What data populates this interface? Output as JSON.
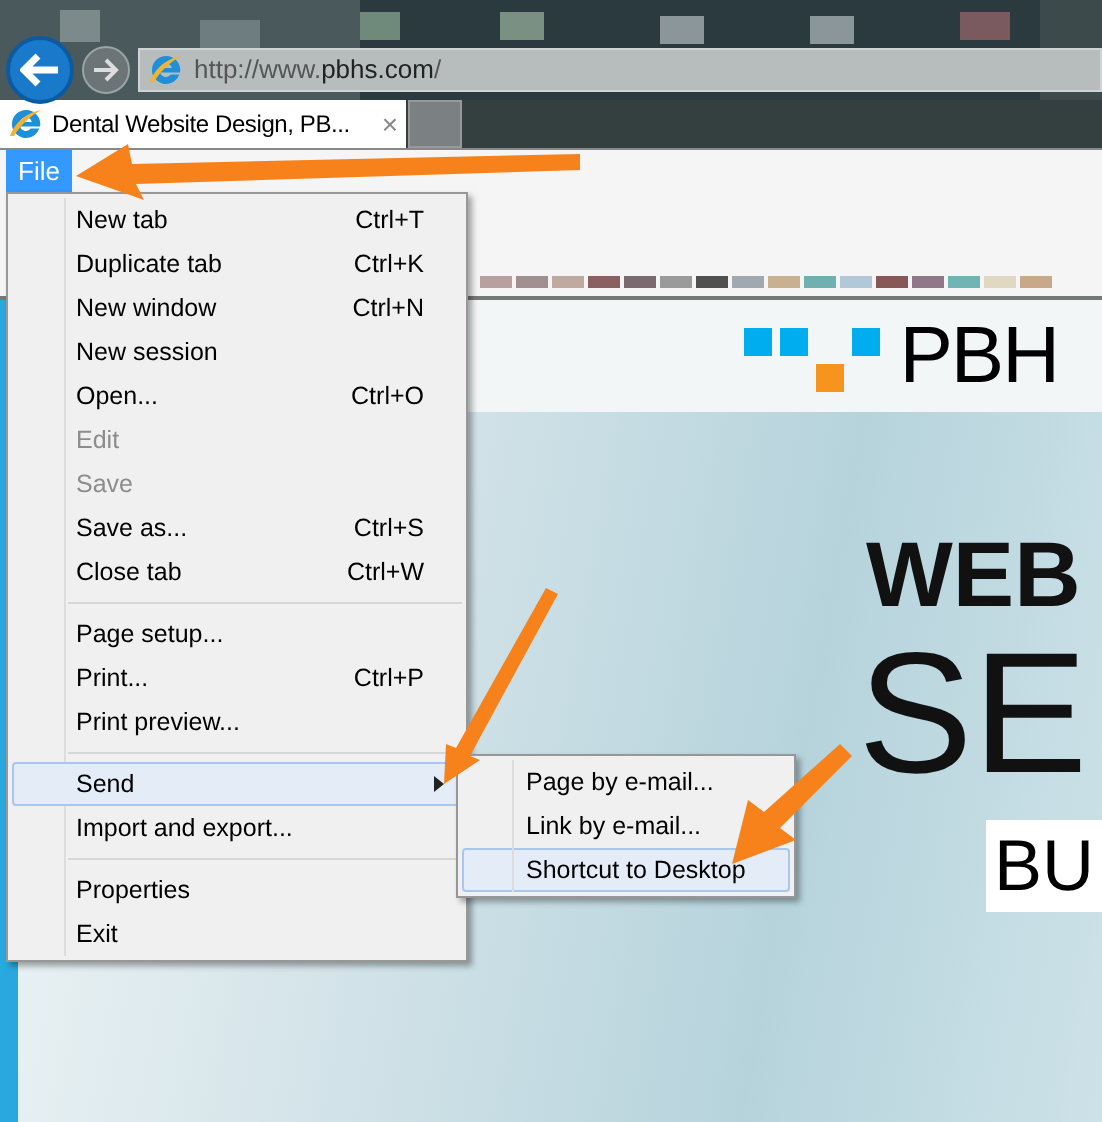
{
  "browser": {
    "address": "http://www.**pbhs.com**/",
    "tab": {
      "title": "Dental Website Design, PB...",
      "close": "×"
    }
  },
  "menu_bar": [
    {
      "label": "File",
      "selected": true
    }
  ],
  "file_menu": [
    {
      "kind": "item",
      "label": "New tab",
      "shortcut": "Ctrl+T",
      "disabled": false,
      "selected": false
    },
    {
      "kind": "item",
      "label": "Duplicate tab",
      "shortcut": "Ctrl+K",
      "disabled": false,
      "selected": false
    },
    {
      "kind": "item",
      "label": "New window",
      "shortcut": "Ctrl+N",
      "disabled": false,
      "selected": false
    },
    {
      "kind": "item",
      "label": "New session",
      "disabled": false,
      "selected": false
    },
    {
      "kind": "item",
      "label": "Open...",
      "shortcut": "Ctrl+O",
      "disabled": false,
      "selected": false
    },
    {
      "kind": "item",
      "label": "Edit",
      "disabled": true,
      "selected": false
    },
    {
      "kind": "item",
      "label": "Save",
      "disabled": true,
      "selected": false
    },
    {
      "kind": "item",
      "label": "Save as...",
      "shortcut": "Ctrl+S",
      "disabled": false,
      "selected": false
    },
    {
      "kind": "item",
      "label": "Close tab",
      "shortcut": "Ctrl+W",
      "disabled": false,
      "selected": false
    },
    {
      "kind": "separator"
    },
    {
      "kind": "item",
      "label": "Page setup...",
      "disabled": false,
      "selected": false
    },
    {
      "kind": "item",
      "label": "Print...",
      "shortcut": "Ctrl+P",
      "disabled": false,
      "selected": false
    },
    {
      "kind": "item",
      "label": "Print preview...",
      "disabled": false,
      "selected": false
    },
    {
      "kind": "separator"
    },
    {
      "kind": "submenu",
      "label": "Send",
      "disabled": false,
      "selected": true
    },
    {
      "kind": "item",
      "label": "Import and export...",
      "disabled": false,
      "selected": false
    },
    {
      "kind": "separator"
    },
    {
      "kind": "item",
      "label": "Properties",
      "disabled": false,
      "selected": false
    },
    {
      "kind": "item",
      "label": "Exit",
      "disabled": false,
      "selected": false
    }
  ],
  "send_submenu": [
    {
      "label": "Page by e-mail...",
      "selected": false
    },
    {
      "label": "Link by e-mail...",
      "selected": false
    },
    {
      "label": "Shortcut to Desktop",
      "selected": true
    }
  ],
  "page": {
    "logo": "PBH",
    "heading_1": "WEB",
    "heading_2": "SE",
    "button": "BU"
  }
}
